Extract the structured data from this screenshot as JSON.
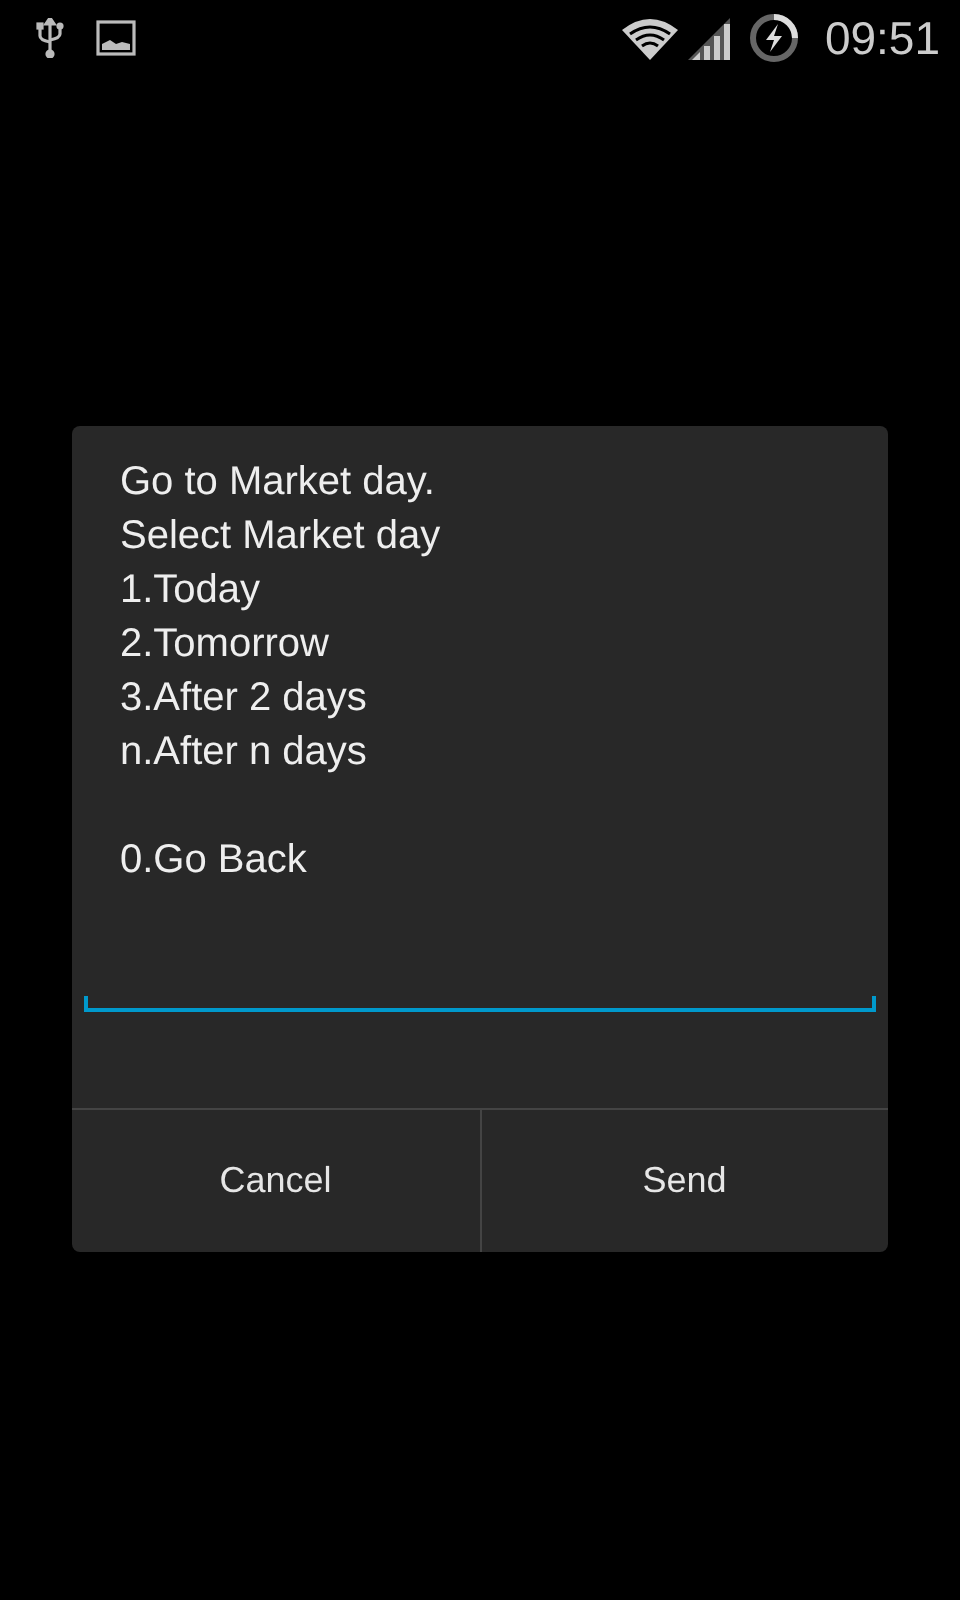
{
  "status_bar": {
    "time": "09:51"
  },
  "dialog": {
    "message_paragraphs": [
      [
        "Go to Market day.",
        "Select Market day",
        "1.Today",
        "2.Tomorrow",
        "3.After 2 days",
        "n.After n days"
      ],
      [
        "0.Go Back"
      ]
    ],
    "input": {
      "focused": true
    },
    "buttons": [
      "Cancel",
      "Send"
    ]
  }
}
